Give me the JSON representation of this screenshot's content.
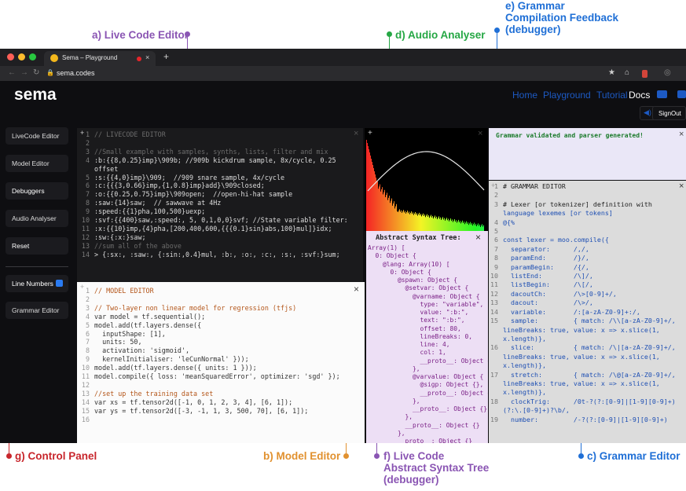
{
  "callouts": {
    "a": "a) Live Code Editor",
    "d": "d) Audio Analyser",
    "e1": "e) Grammar",
    "e2": "Compilation Feedback",
    "e3": "(debugger)",
    "g": "g) Control Panel",
    "b": "b) Model Editor",
    "f1": "f) Live Code",
    "f2": "Abstract Syntax Tree",
    "f3": "(debugger)",
    "c": "c) Grammar Editor"
  },
  "colors": {
    "purple": "#8a55b3",
    "green": "#25a744",
    "blue": "#1f6fd6",
    "red": "#c8262c",
    "orange": "#e1912f"
  },
  "browser": {
    "tab_title": "Sema – Playground",
    "url": "sema.codes",
    "tab_icon": "emoji-face-icon",
    "new_tab": "+"
  },
  "nav": {
    "logo": "sema",
    "home": "Home",
    "playground": "Playground",
    "tutorial": "Tutorial",
    "docs": "Docs",
    "signout": "SignOut"
  },
  "panel": {
    "livecode": "LiveCode Editor",
    "model": "Model Editor",
    "debuggers": "Debuggers",
    "audio": "Audio Analyser",
    "reset": "Reset",
    "line_numbers": "Line Numbers",
    "grammar": "Grammar Editor"
  },
  "live_code": [
    "// LIVECODE EDITOR",
    "",
    "//Small example with samples, synths, lists, filter and mix",
    ":b:{{8,0.25}imp}\\909b; //909b kickdrum sample, 8x/cycle, 0.25",
    "offset",
    ":s:{{4,0}imp}\\909;  //909 snare sample, 4x/cycle",
    ":c:{{{3,0.66}imp,{1,0.8}imp}add}\\909closed;",
    ":o:{{0.25,0.75}imp}\\909open;  //open-hi-hat sample",
    ":saw:{14}saw;  // sawwave at 4Hz",
    ":speed:{{1}pha,100,500}uexp;",
    ":svf:{{400}saw,:speed:, 5, 0,1,0,0}svf; //State variable filter:",
    ":x:{{10}imp,{4}pha,[200,400,600,{{{0.1}sin}abs,100}mul]}idx;",
    ":sw:{:x:}saw;",
    "//sum all of the above",
    "> {:sx:, :saw:, {:sin:,0.4}mul, :b:, :o:, :c:, :s:, :svf:}sum;"
  ],
  "live_code_nums": [
    "1",
    "2",
    "3",
    "4",
    "",
    "5",
    "6",
    "7",
    "8",
    "9",
    "10",
    "11",
    "12",
    "13",
    "14"
  ],
  "model_code": [
    "// MODEL EDITOR",
    "",
    "// Two-layer non linear model for regression (tfjs)",
    "var model = tf.sequential();",
    "model.add(tf.layers.dense({",
    "  inputShape: [1],",
    "  units: 50,",
    "  activation: 'sigmoid',",
    "  kernelInitialiser: 'leCunNormal' }));",
    "model.add(tf.layers.dense({ units: 1 }));",
    "model.compile({ loss: 'meanSquaredError', optimizer: 'sgd' });",
    "",
    "//set up the training data set",
    "var xs = tf.tensor2d([-1, 0, 1, 2, 3, 4], [6, 1]);",
    "var ys = tf.tensor2d([-3, -1, 1, 3, 500, 70], [6, 1]);",
    ""
  ],
  "feedback": "Grammar validated and parser generated!",
  "ast": {
    "title": "Abstract Syntax Tree:",
    "lines": [
      "Array(1) [",
      "  0: Object {",
      "    @lang: Array(10) [",
      "      0: Object {",
      "        @spawn: Object {",
      "          @setvar: Object {",
      "            @varname: Object {",
      "              type: \"variable\",",
      "              value: \":b:\",",
      "              text: \":b:\",",
      "              offset: 80,",
      "              lineBreaks: 0,",
      "              line: 4,",
      "              col: 1,",
      "              __proto__: Object {}",
      "            },",
      "            @varvalue: Object {",
      "              @sigp: Object {},",
      "              __proto__: Object {}",
      "            },",
      "            __proto__: Object {}",
      "          },",
      "          __proto__: Object {}",
      "        },",
      "        __proto__: Object {}"
    ]
  },
  "grammar_code": [
    "# GRAMMAR EDITOR",
    "",
    "# Lexer [or tokenizer] definition with",
    "language lexemes [or tokens]",
    "@{%",
    "",
    "const lexer = moo.compile({",
    "  separator:      /,/,",
    "  paramEnd:       /}/,",
    "  paramBegin:     /{/,",
    "  listEnd:        /\\]/,",
    "  listBegin:      /\\[/,",
    "  dacoutCh:       /\\>[0-9]+/,",
    "  dacout:         /\\>/,",
    "  variable:       /:[a-zA-Z0-9]+:/,",
    "  sample:         { match: /\\\\[a-zA-Z0-9]+/,",
    "lineBreaks: true, value: x => x.slice(1,",
    "x.length)},",
    "  slice:          { match: /\\|[a-zA-Z0-9]+/,",
    "lineBreaks: true, value: x => x.slice(1,",
    "x.length)},",
    "  stretch:        { match: /\\@[a-zA-Z0-9]+/,",
    "lineBreaks: true, value: x => x.slice(1,",
    "x.length)},",
    "  clockTrig:      /0t-?(?:[0-9]|[1-9][0-9]+)",
    "(?:\\.[0-9]+)?\\b/,",
    "  number:         /-?(?:[0-9]|[1-9][0-9]+)"
  ],
  "grammar_nums": [
    "1",
    "2",
    "3",
    "",
    "4",
    "5",
    "6",
    "7",
    "8",
    "9",
    "10",
    "11",
    "12",
    "13",
    "14",
    "15",
    "",
    "",
    "16",
    "",
    "",
    "17",
    "",
    "",
    "18",
    "",
    "19"
  ]
}
